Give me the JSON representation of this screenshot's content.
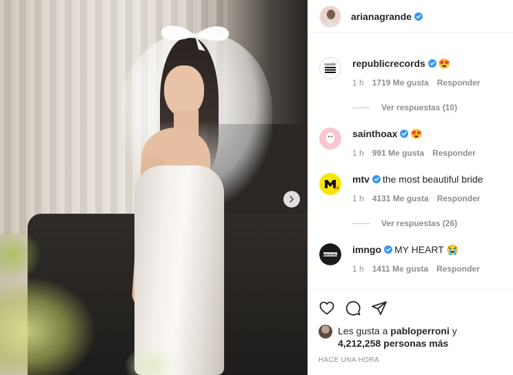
{
  "header": {
    "username": "arianagrande"
  },
  "comments": [
    {
      "username": "republicrecords",
      "text": "😍",
      "time": "1 h",
      "likes": "1719 Me gusta",
      "reply": "Responder",
      "view_replies": "Ver respuestas (10)"
    },
    {
      "username": "sainthoax",
      "text": "😍",
      "time": "1 h",
      "likes": "991 Me gusta",
      "reply": "Responder"
    },
    {
      "username": "mtv",
      "text": "the most beautiful bride",
      "time": "1 h",
      "likes": "4131 Me gusta",
      "reply": "Responder",
      "view_replies": "Ver respuestas (26)"
    },
    {
      "username": "imngo",
      "text": "MY HEART 😭",
      "time": "1 h",
      "likes": "1411 Me gusta",
      "reply": "Responder"
    }
  ],
  "likes": {
    "prefix": "Les gusta a",
    "user": "pabloperroni",
    "joiner": "y",
    "count": "4,212,258 personas más"
  },
  "timestamp": "HACE UNA HORA",
  "colors": {
    "verified": "#3897f0",
    "text": "#262626",
    "muted": "#8e8e8e"
  },
  "icons": [
    "heart-icon",
    "comment-icon",
    "share-icon",
    "next-arrow-icon",
    "verified-badge-icon"
  ]
}
